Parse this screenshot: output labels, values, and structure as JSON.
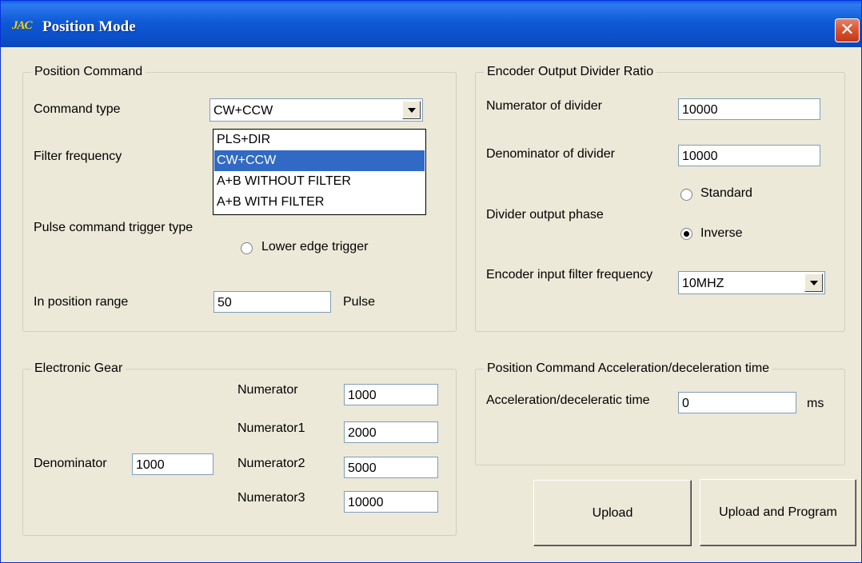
{
  "window": {
    "title": "Position Mode",
    "app_icon": "JAC",
    "close_glyph": "✕"
  },
  "position_command": {
    "legend": "Position Command",
    "command_type_label": "Command type",
    "command_type_value": "CW+CCW",
    "command_type_options": [
      "PLS+DIR",
      "CW+CCW",
      "A+B WITHOUT FILTER",
      "A+B WITH FILTER"
    ],
    "filter_frequency_label": "Filter frequency",
    "pulse_trigger_label": "Pulse command trigger type",
    "lower_edge_label": "Lower edge trigger",
    "in_position_label": "In position range",
    "in_position_value": "50",
    "in_position_unit": "Pulse"
  },
  "encoder_divider": {
    "legend": "Encoder Output Divider Ratio",
    "numerator_label": "Numerator of divider",
    "numerator_value": "10000",
    "denominator_label": "Denominator of divider",
    "denominator_value": "10000",
    "phase_label": "Divider output phase",
    "standard_label": "Standard",
    "inverse_label": "Inverse",
    "selected_phase": "Inverse",
    "filter_label": "Encoder input filter frequency",
    "filter_value": "10MHZ"
  },
  "electronic_gear": {
    "legend": "Electronic Gear",
    "denominator_label": "Denominator",
    "denominator_value": "1000",
    "numerator_label": "Numerator",
    "numerator_value": "1000",
    "numerator1_label": "Numerator1",
    "numerator1_value": "2000",
    "numerator2_label": "Numerator2",
    "numerator2_value": "5000",
    "numerator3_label": "Numerator3",
    "numerator3_value": "10000"
  },
  "accel_decel": {
    "legend": "Position Command Acceleration/deceleration time",
    "label": "Acceleration/deceleratic time",
    "value": "0",
    "unit": "ms"
  },
  "buttons": {
    "upload": "Upload",
    "upload_program": "Upload and Program"
  }
}
